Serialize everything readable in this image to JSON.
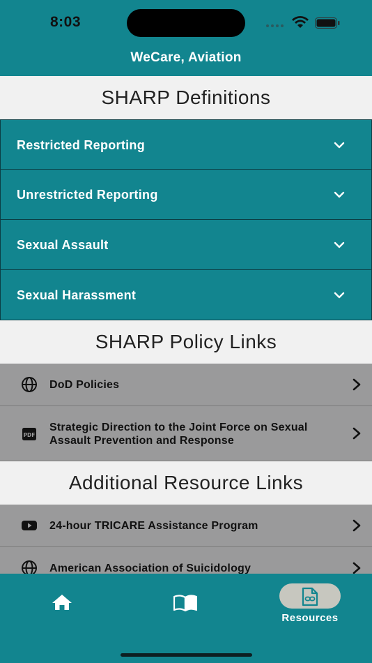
{
  "status_bar": {
    "time": "8:03"
  },
  "header": {
    "title": "WeCare, Aviation"
  },
  "sections": {
    "definitions": {
      "title": "SHARP Definitions",
      "items": [
        {
          "label": "Restricted Reporting"
        },
        {
          "label": "Unrestricted Reporting"
        },
        {
          "label": "Sexual Assault"
        },
        {
          "label": "Sexual Harassment"
        }
      ]
    },
    "policy_links": {
      "title": "SHARP Policy Links",
      "items": [
        {
          "label": "DoD Policies",
          "icon": "globe-icon"
        },
        {
          "label": "Strategic Direction to the Joint Force on Sexual Assault Prevention and Response",
          "icon": "pdf-icon"
        }
      ]
    },
    "additional_links": {
      "title": "Additional Resource Links",
      "items": [
        {
          "label": "24-hour TRICARE Assistance Program",
          "icon": "youtube-icon"
        },
        {
          "label": "American Association of Suicidology",
          "icon": "globe-icon"
        }
      ]
    }
  },
  "tab_bar": {
    "tabs": [
      {
        "name": "home",
        "icon": "home-icon"
      },
      {
        "name": "library",
        "icon": "book-icon"
      },
      {
        "name": "resources",
        "label": "Resources",
        "icon": "link-document-icon",
        "selected": true
      }
    ]
  },
  "colors": {
    "teal": "#12858f",
    "gray_row": "#9a9a9b",
    "section_bg": "#f1f1f1",
    "pill": "#c7c7bf"
  }
}
